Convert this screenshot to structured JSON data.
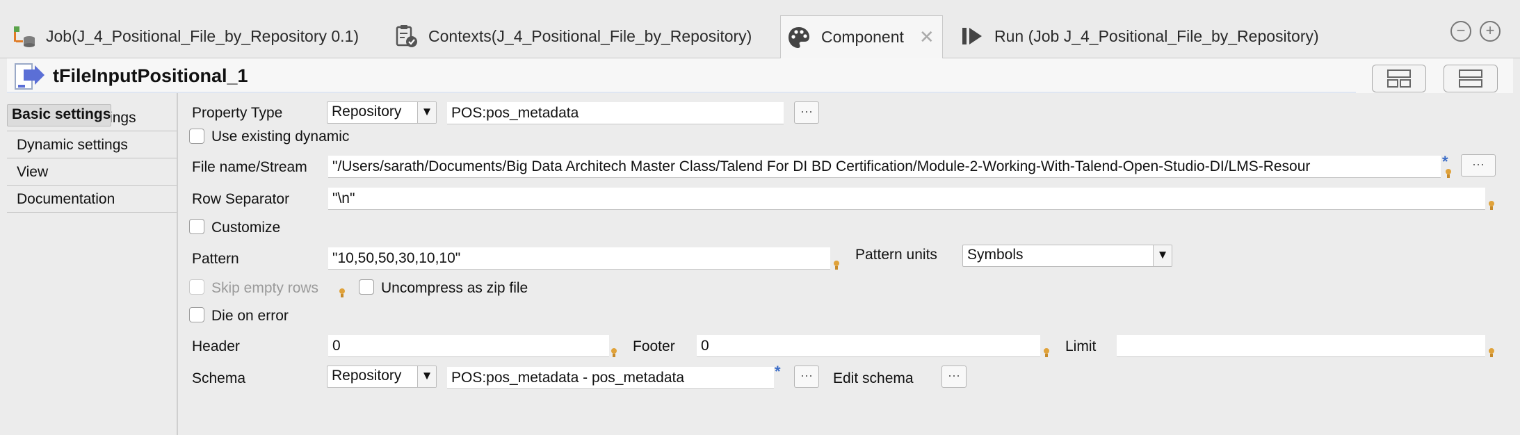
{
  "tabs": [
    {
      "label": "Job(J_4_Positional_File_by_Repository 0.1)",
      "icon": "job-icon"
    },
    {
      "label": "Contexts(J_4_Positional_File_by_Repository)",
      "icon": "contexts-icon"
    },
    {
      "label": "Component",
      "icon": "palette-icon",
      "close": "✕"
    },
    {
      "label": "Run (Job J_4_Positional_File_by_Repository)",
      "icon": "run-icon"
    }
  ],
  "window": {
    "minimize": "−",
    "maximize": "+"
  },
  "component": {
    "title": "tFileInputPositional_1"
  },
  "nav": {
    "items": [
      "Basic settings",
      "Advanced settings",
      "Dynamic settings",
      "View",
      "Documentation"
    ]
  },
  "form": {
    "property_type_label": "Property Type",
    "property_type_value": "Repository",
    "property_value": "POS:pos_metadata",
    "dots": "···",
    "use_existing_dynamic": "Use existing dynamic",
    "file_name_label": "File name/Stream",
    "file_name_value": "\"/Users/sarath/Documents/Big Data Architech Master Class/Talend For DI BD Certification/Module-2-Working-With-Talend-Open-Studio-DI/LMS-Resour",
    "row_separator_label": "Row Separator",
    "row_separator_value": "\"\\n\"",
    "customize": "Customize",
    "pattern_label": "Pattern",
    "pattern_value": "\"10,50,50,30,10,10\"",
    "pattern_units_label": "Pattern units",
    "pattern_units_value": "Symbols",
    "skip_empty_rows": "Skip empty rows",
    "uncompress_zip": "Uncompress as zip file",
    "die_on_error": "Die on error",
    "header_label": "Header",
    "header_value": "0",
    "footer_label": "Footer",
    "footer_value": "0",
    "limit_label": "Limit",
    "limit_value": "",
    "schema_label": "Schema",
    "schema_type_value": "Repository",
    "schema_value": "POS:pos_metadata - pos_metadata",
    "edit_schema": "Edit schema",
    "required_marker": "*"
  },
  "colors": {
    "accent": "#3a6cc7",
    "bulb": "#e0a23a"
  }
}
